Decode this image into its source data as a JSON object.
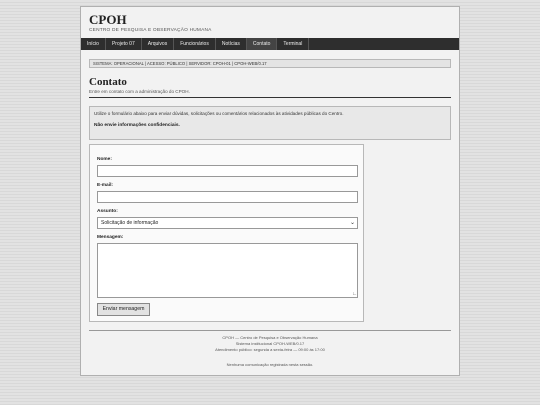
{
  "header": {
    "title": "CPOH",
    "subtitle": "CENTRO DE PESQUISA E OBSERVAÇÃO HUMANA"
  },
  "nav": {
    "items": [
      {
        "label": "Início"
      },
      {
        "label": "Projeto 07"
      },
      {
        "label": "Arquivos"
      },
      {
        "label": "Funcionários"
      },
      {
        "label": "Notícias"
      },
      {
        "label": "Contato"
      },
      {
        "label": "Terminal"
      }
    ],
    "active": "Contato"
  },
  "status_bar": "SISTEMA: OPERACIONAL | ACESSO: PÚBLICO | SERVIDOR: CPOH-01 | CPOH-WEB/0.17",
  "page": {
    "title": "Contato",
    "subtitle": "Entre em contato com a administração do CPOH."
  },
  "notice": {
    "text": "Utilize o formulário abaixo para enviar dúvidas, solicitações ou comentários relacionados às atividades públicas do Centro.",
    "warning": "Não envie informações confidenciais."
  },
  "form": {
    "name_label": "Nome:",
    "name_value": "",
    "email_label": "E-mail:",
    "email_value": "",
    "subject_label": "Assunto:",
    "subject_selected": "Solicitação de informação",
    "message_label": "Mensagem:",
    "message_value": "",
    "submit_label": "Enviar mensagem"
  },
  "footer": {
    "line1": "CPOH — Centro de Pesquisa e Observação Humana",
    "line2": "Sistema institucional CPOH-WEB/0.17",
    "line3": "Atendimento público: segunda a sexta-feira — 09:00 às 17:00",
    "line4": "Nenhuma comunicação registrada nesta sessão."
  },
  "icons": {
    "select": "chevron-down-icon",
    "textarea": "resize-handle-icon"
  }
}
